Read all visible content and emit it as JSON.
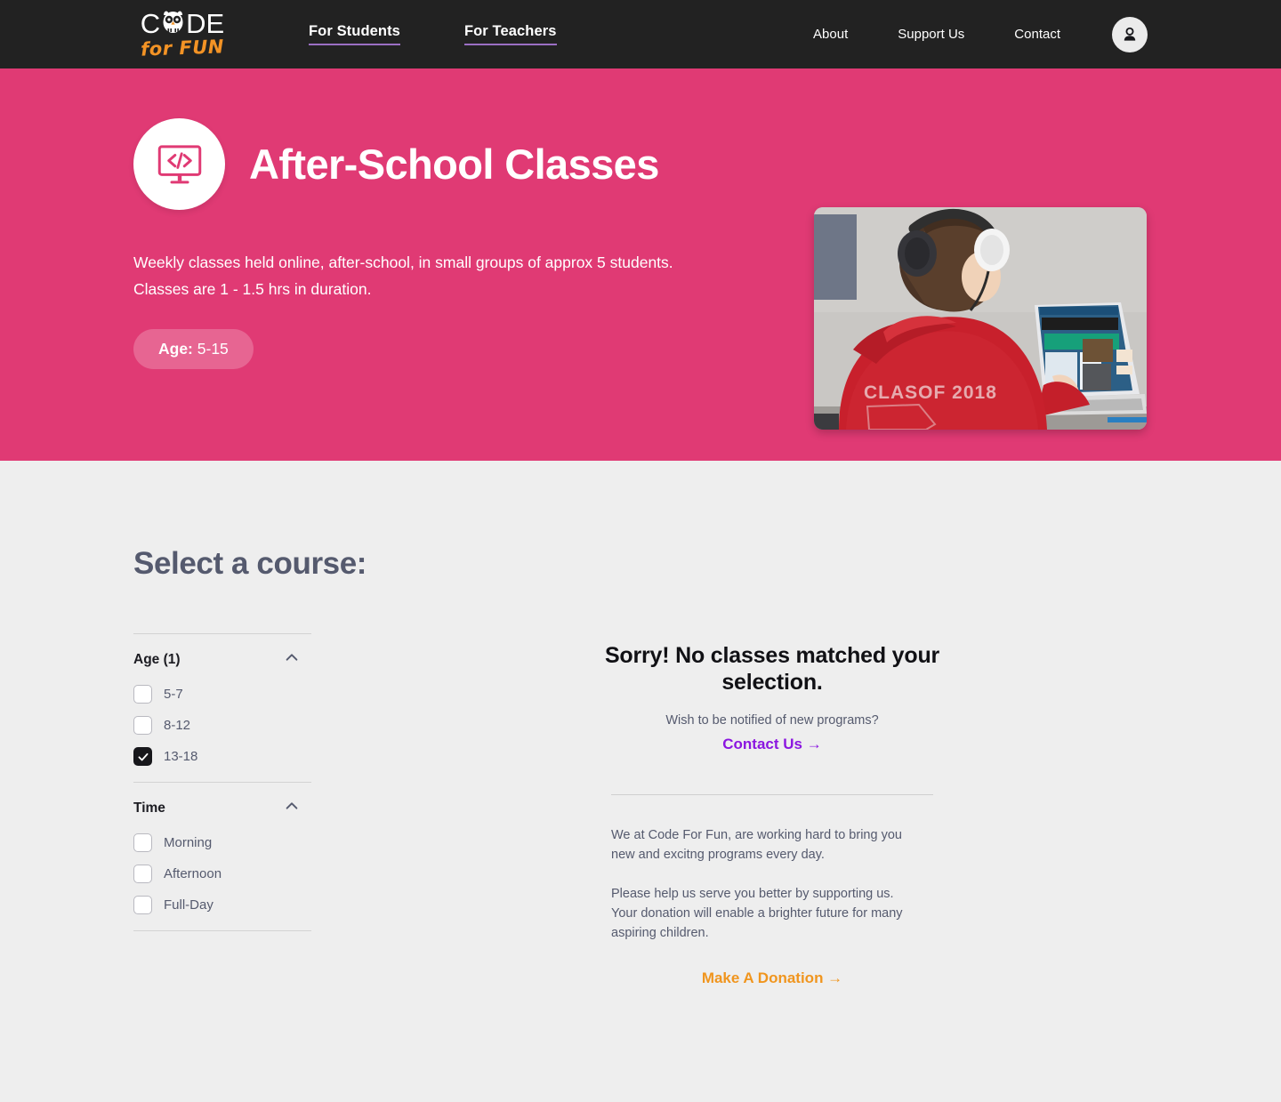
{
  "header": {
    "logo": {
      "word_start": "C",
      "word_end": "DE",
      "tagline": "for FUN",
      "owl_icon": "owl-icon"
    },
    "nav_main": [
      {
        "label": "For Students"
      },
      {
        "label": "For Teachers"
      }
    ],
    "nav_right": [
      {
        "label": "About"
      },
      {
        "label": "Support Us"
      },
      {
        "label": "Contact"
      }
    ],
    "account_icon": "user-account-icon"
  },
  "hero": {
    "icon": "code-monitor-icon",
    "title": "After-School Classes",
    "description": "Weekly classes held online, after-school, in small groups of approx 5 students. Classes are 1 - 1.5 hrs in duration.",
    "age_pill_label": "Age:",
    "age_pill_value": " 5-15",
    "photo_alt": "student-in-red-hoodie-with-headphones-at-laptop",
    "background_color": "#e03a74"
  },
  "main": {
    "section_title": "Select a course:",
    "filters": [
      {
        "title": "Age (1)",
        "collapse_icon": "chevron-up-icon",
        "options": [
          {
            "label": "5-7",
            "checked": false
          },
          {
            "label": "8-12",
            "checked": false
          },
          {
            "label": "13-18",
            "checked": true
          }
        ]
      },
      {
        "title": "Time",
        "collapse_icon": "chevron-up-icon",
        "options": [
          {
            "label": "Morning",
            "checked": false
          },
          {
            "label": "Afternoon",
            "checked": false
          },
          {
            "label": "Full-Day",
            "checked": false
          }
        ]
      }
    ],
    "results": {
      "no_result_title": "Sorry! No classes matched your selection.",
      "no_result_subtitle": "Wish to be notified of new programs?",
      "contact_link": "Contact Us →",
      "promo_paragraph_1": "We at Code For Fun, are working hard to bring you new and excitng programs every day.",
      "promo_paragraph_2": "Please help us serve you better by supporting us. Your donation will enable a brighter future for many aspiring children.",
      "donation_link": "Make A Donation →"
    }
  },
  "colors": {
    "brand_pink": "#e03a74",
    "header_dark": "#222222",
    "accent_orange": "#f0951e",
    "accent_purple": "#8b16e0",
    "nav_underline": "#9b6fc4"
  }
}
